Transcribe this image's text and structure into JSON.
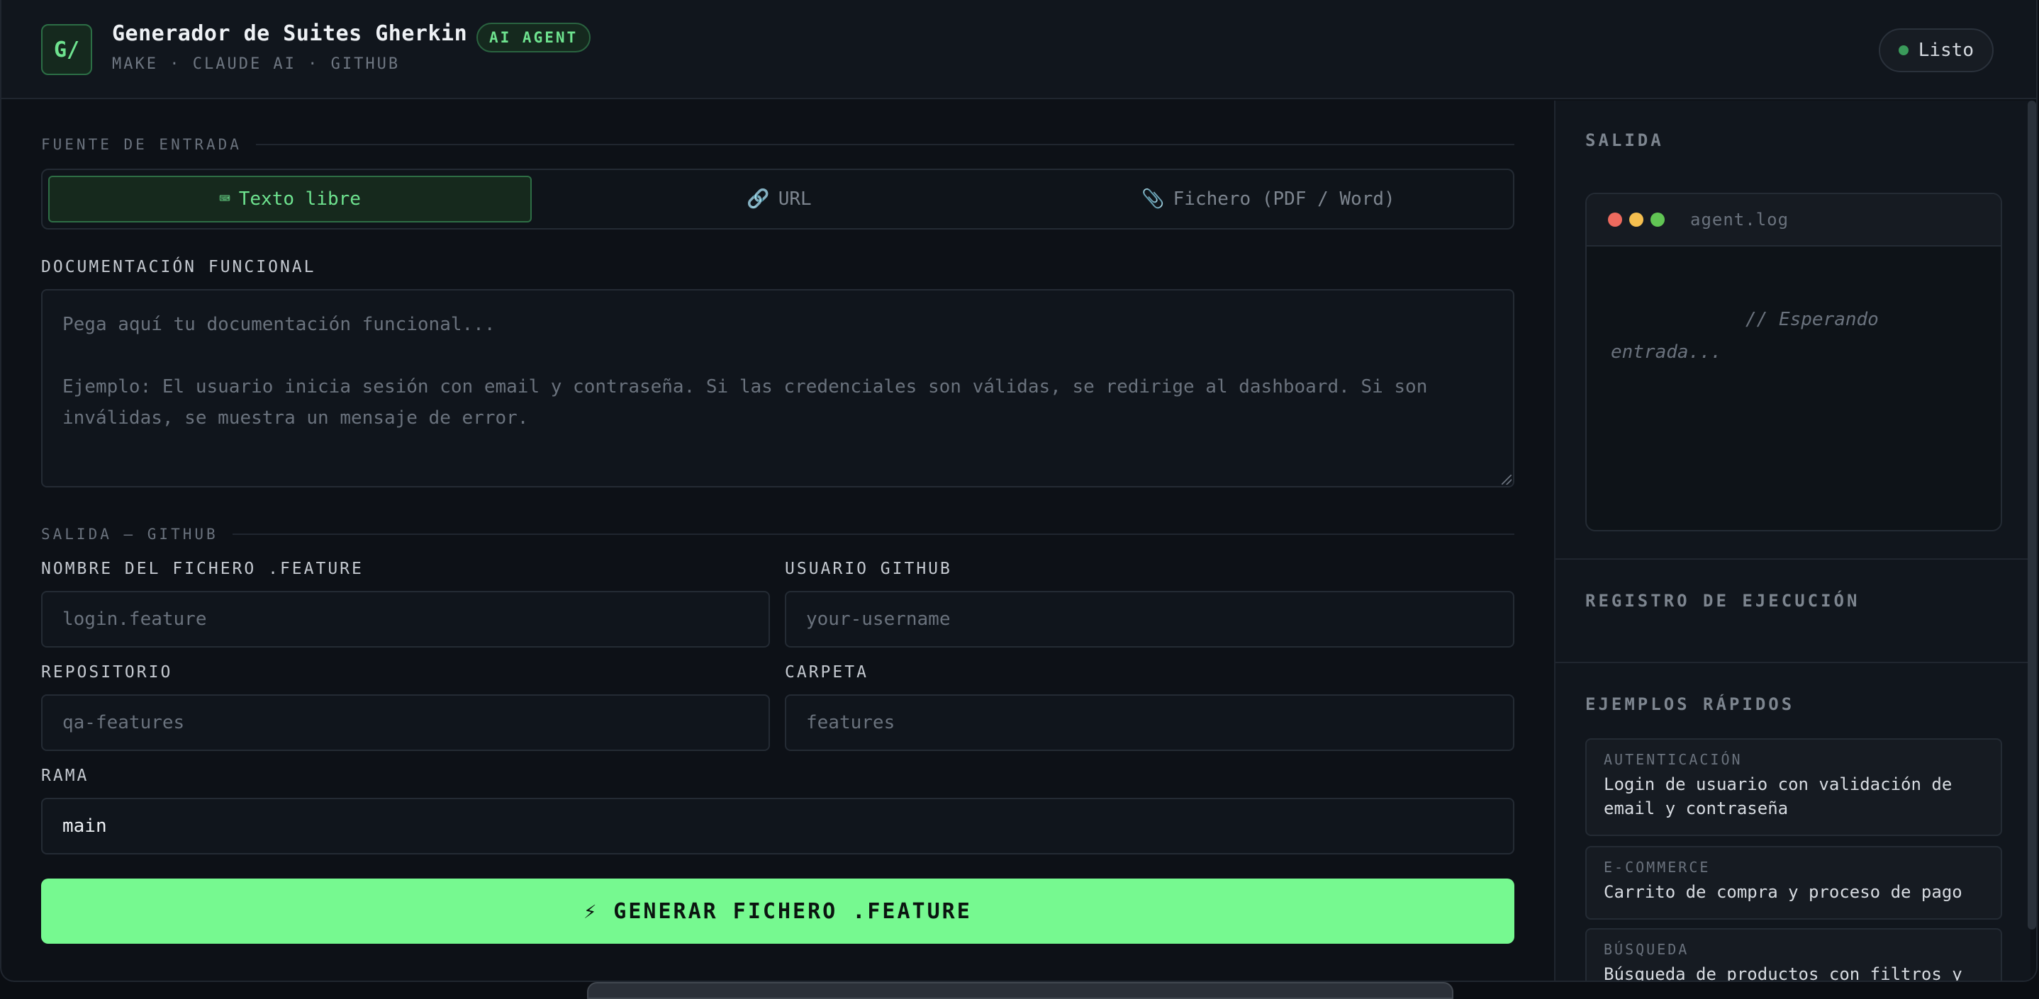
{
  "header": {
    "logo": "G/",
    "title": "Generador de Suites Gherkin",
    "badge": "AI AGENT",
    "subtitle": "MAKE · CLAUDE AI · GITHUB",
    "status": "Listo"
  },
  "input_source": {
    "section_title": "FUENTE DE ENTRADA",
    "tabs": [
      {
        "icon": "⌨",
        "label": "Texto libre",
        "active": true
      },
      {
        "icon": "🔗",
        "label": "URL",
        "active": false
      },
      {
        "icon": "📎",
        "label": "Fichero (PDF / Word)",
        "active": false
      }
    ]
  },
  "doc": {
    "label": "DOCUMENTACIÓN FUNCIONAL",
    "placeholder": "Pega aquí tu documentación funcional...\n\nEjemplo: El usuario inicia sesión con email y contraseña. Si las credenciales son válidas, se redirige al dashboard. Si son\ninválidas, se muestra un mensaje de error."
  },
  "github": {
    "section_title": "SALIDA — GITHUB",
    "filename_label": "NOMBRE DEL FICHERO .FEATURE",
    "filename_placeholder": "login.feature",
    "user_label": "USUARIO GITHUB",
    "user_placeholder": "your-username",
    "repo_label": "REPOSITORIO",
    "repo_placeholder": "qa-features",
    "folder_label": "CARPETA",
    "folder_placeholder": "features",
    "branch_label": "RAMA",
    "branch_value": "main"
  },
  "generate_button": "⚡ GENERAR FICHERO .FEATURE",
  "side": {
    "output_title": "SALIDA",
    "log_name": "agent.log",
    "log_text": "// Esperando entrada...",
    "run_log_title": "REGISTRO DE EJECUCIÓN",
    "examples_title": "EJEMPLOS RÁPIDOS",
    "examples": [
      {
        "category": "AUTENTICACIÓN",
        "description": "Login de usuario con validación de email y contraseña"
      },
      {
        "category": "E-COMMERCE",
        "description": "Carrito de compra y proceso de pago"
      },
      {
        "category": "BÚSQUEDA",
        "description": "Búsqueda de productos con filtros y"
      }
    ]
  },
  "colors": {
    "accent": "#76f990",
    "background": "#0d1117",
    "dot_red": "#ed6a5e",
    "dot_yellow": "#f5bf4f",
    "dot_green": "#61c554"
  }
}
